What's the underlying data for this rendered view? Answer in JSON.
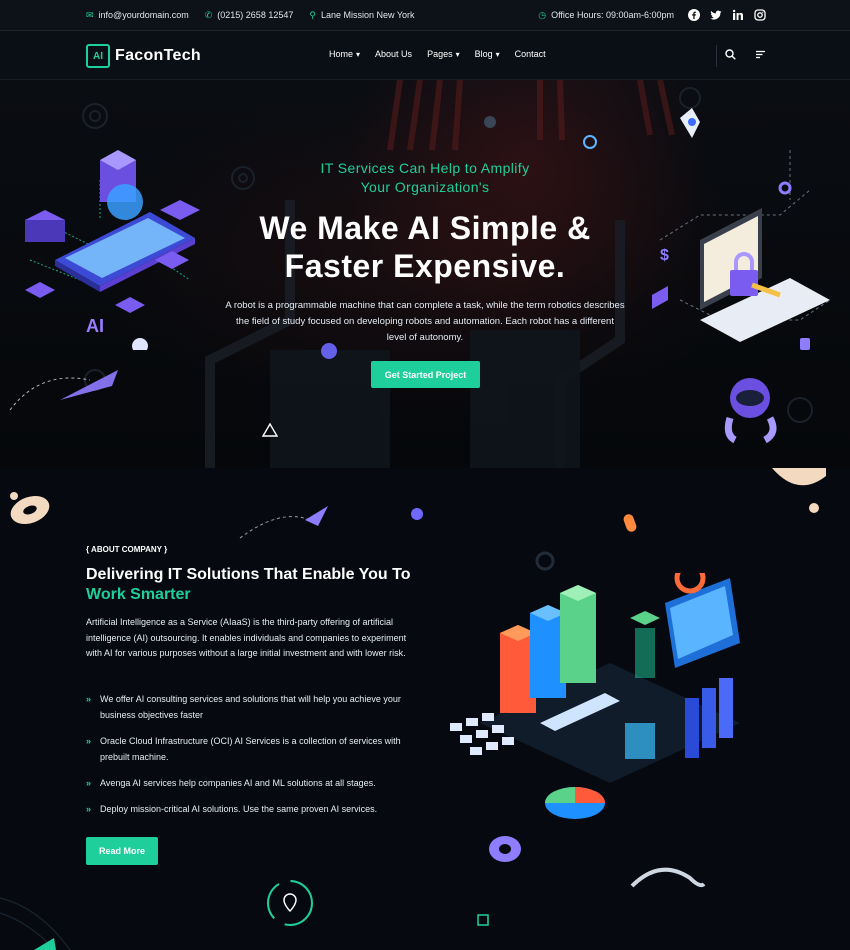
{
  "topbar": {
    "email": "info@yourdomain.com",
    "phone": "(0215) 2658 12547",
    "location": "Lane Mission New York",
    "office_hours": "Office Hours: 09:00am-6:00pm",
    "social_icons": [
      "facebook-icon",
      "twitter-icon",
      "linkedin-icon",
      "instagram-icon"
    ]
  },
  "navbar": {
    "logo_chip": "AI",
    "logo_text": "FaconTech",
    "items": [
      {
        "label": "Home"
      },
      {
        "label": "About Us"
      },
      {
        "label": "Pages"
      },
      {
        "label": "Blog"
      },
      {
        "label": "Contact"
      }
    ]
  },
  "hero": {
    "subtitle_line1": "IT Services Can Help to Amplify",
    "subtitle_line2": "Your Organization's",
    "title_line1": "We Make AI Simple &",
    "title_line2": "Faster Expensive.",
    "description": "A robot is a programmable machine that can complete a task, while the term robotics describes the field of study focused on developing robots and automation. Each robot has a different level of autonomy.",
    "button_label": "Get Started Project",
    "illustration_label": "AI"
  },
  "about": {
    "tag": "{ ABOUT COMPANY }",
    "title_part1": "Delivering IT Solutions That Enable You To ",
    "title_highlight": "Work Smarter",
    "text": "Artificial Intelligence as a Service (AIaaS) is the third-party offering of artificial intelligence (AI) outsourcing. It enables individuals and companies to experiment with AI for various purposes without a large initial investment and with lower risk.",
    "features": [
      "We offer AI consulting services and solutions that will help you achieve your business objectives faster",
      "Oracle Cloud Infrastructure (OCI) AI Services is a collection of services with prebuilt machine.",
      "Avenga AI services help companies AI and ML solutions at all stages.",
      "Deploy mission-critical AI solutions. Use the same proven AI services."
    ],
    "button_label": "Read More"
  },
  "colors": {
    "accent": "#1fcf9b",
    "background": "#070b12",
    "purple": "#7b5cf0"
  }
}
